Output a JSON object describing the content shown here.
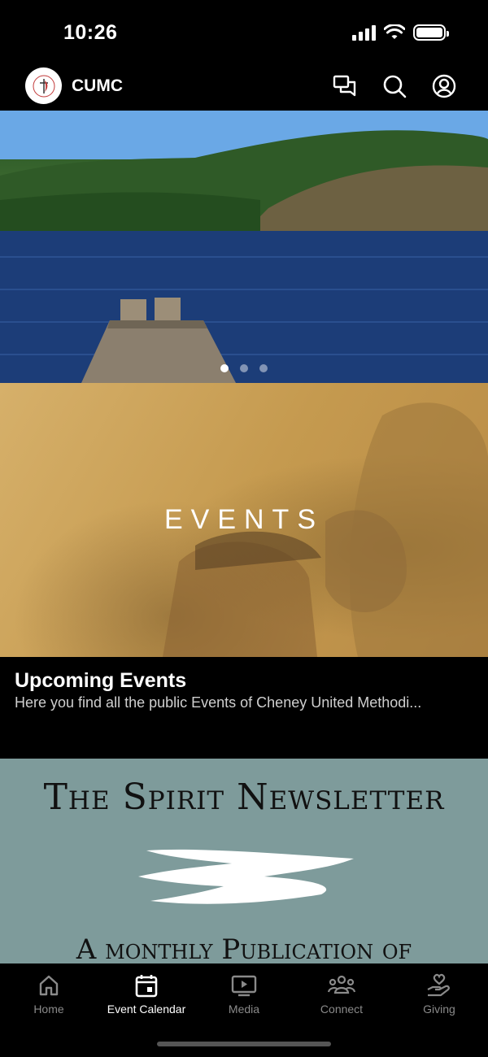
{
  "status": {
    "time": "10:26"
  },
  "header": {
    "brand": "CUMC"
  },
  "hero": {
    "carousel_total": 3,
    "carousel_active": 1
  },
  "events_card": {
    "image_text": "EVENTS",
    "title": "Upcoming Events",
    "description": "Here you find all the public Events of Cheney United Methodi..."
  },
  "newsletter": {
    "title": "The Spirit Newsletter",
    "subtitle": "A monthly Publication of"
  },
  "tabs": [
    {
      "label": "Home",
      "icon": "home-icon",
      "active": false
    },
    {
      "label": "Event Calendar",
      "icon": "calendar-icon",
      "active": true
    },
    {
      "label": "Media",
      "icon": "media-icon",
      "active": false
    },
    {
      "label": "Connect",
      "icon": "people-icon",
      "active": false
    },
    {
      "label": "Giving",
      "icon": "giving-icon",
      "active": false
    }
  ],
  "colors": {
    "background": "#000000",
    "events_tint": "#c9a058",
    "newsletter_bg": "#7e9b9b",
    "tab_inactive": "#8a8a8a"
  }
}
